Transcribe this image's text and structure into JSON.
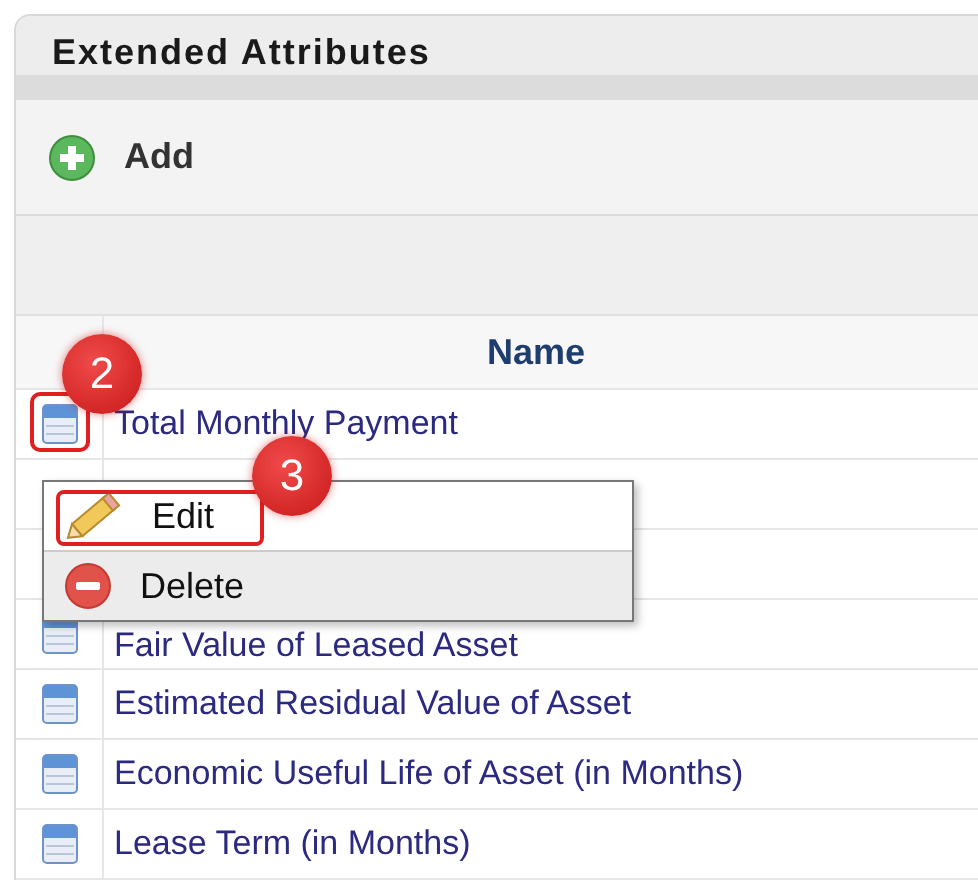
{
  "panel": {
    "title": "Extended Attributes"
  },
  "toolbar": {
    "add_label": "Add"
  },
  "table": {
    "columns": [
      "Name"
    ],
    "rows": [
      {
        "name": "Total Monthly Payment",
        "callout": "2"
      },
      {
        "name": null
      },
      {
        "name": null
      },
      {
        "name": "Fair Value of Leased Asset"
      },
      {
        "name": "Estimated Residual Value of Asset"
      },
      {
        "name": "Economic Useful Life of Asset (in Months)"
      },
      {
        "name": "Lease Term (in Months)"
      }
    ]
  },
  "context_menu": {
    "items": [
      {
        "kind": "edit",
        "label": "Edit",
        "selected": true,
        "callout": "3"
      },
      {
        "kind": "delete",
        "label": "Delete",
        "selected": false
      }
    ]
  }
}
